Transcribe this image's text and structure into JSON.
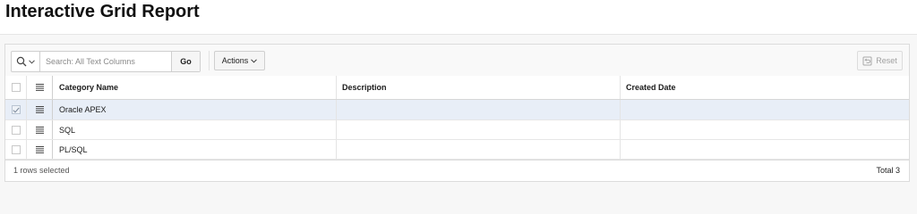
{
  "page": {
    "title": "Interactive Grid Report"
  },
  "toolbar": {
    "search_icon": "search-icon",
    "search_placeholder": "Search: All Text Columns",
    "search_value": "",
    "go_label": "Go",
    "actions_label": "Actions",
    "reset_label": "Reset"
  },
  "grid": {
    "columns": [
      "Category Name",
      "Description",
      "Created Date"
    ],
    "rows": [
      {
        "category": "Oracle APEX",
        "description": "",
        "created": "",
        "selected": true
      },
      {
        "category": "SQL",
        "description": "",
        "created": "",
        "selected": false
      },
      {
        "category": "PL/SQL",
        "description": "",
        "created": "",
        "selected": false
      }
    ]
  },
  "footer": {
    "selection_text": "1 rows selected",
    "total_text": "Total 3"
  },
  "colors": {
    "selected_row": "#e8eef7",
    "page_bg": "#f7f7f7"
  }
}
